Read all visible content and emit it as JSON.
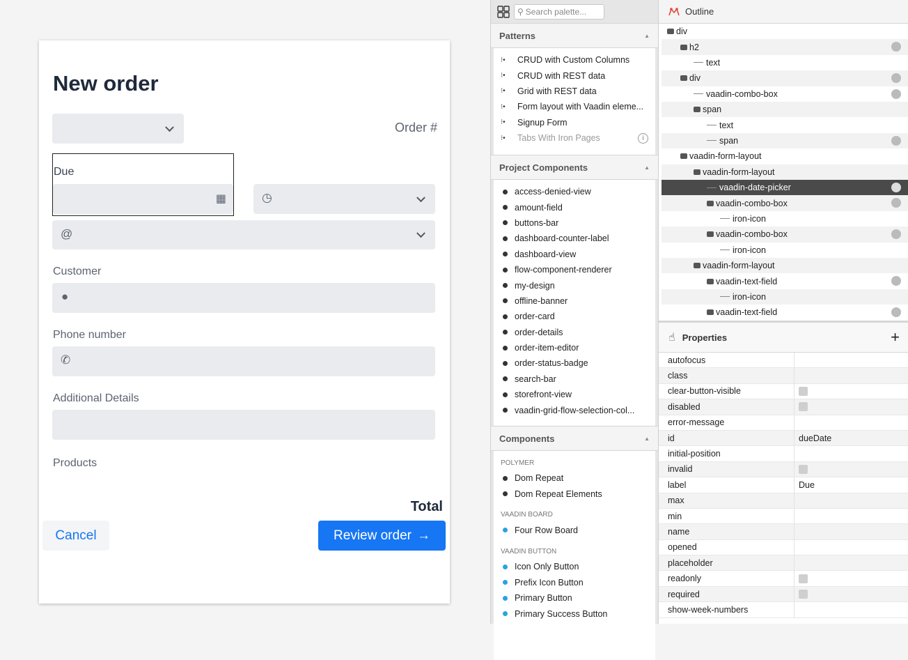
{
  "form": {
    "title": "New order",
    "order_number_label": "Order #",
    "due_label": "Due",
    "customer_label": "Customer",
    "phone_label": "Phone number",
    "details_label": "Additional Details",
    "products_label": "Products",
    "total_label": "Total",
    "cancel_label": "Cancel",
    "review_label": "Review order"
  },
  "palette": {
    "search_placeholder": "Search palette...",
    "patterns_header": "Patterns",
    "patterns": [
      {
        "label": "CRUD with Custom Columns",
        "dim": false
      },
      {
        "label": "CRUD with REST data",
        "dim": false
      },
      {
        "label": "Grid with REST data",
        "dim": false
      },
      {
        "label": "Form layout with Vaadin eleme...",
        "dim": false
      },
      {
        "label": "Signup Form",
        "dim": false
      },
      {
        "label": "Tabs With Iron Pages",
        "dim": true
      }
    ],
    "project_header": "Project Components",
    "project_components": [
      "access-denied-view",
      "amount-field",
      "buttons-bar",
      "dashboard-counter-label",
      "dashboard-view",
      "flow-component-renderer",
      "my-design",
      "offline-banner",
      "order-card",
      "order-details",
      "order-item-editor",
      "order-status-badge",
      "search-bar",
      "storefront-view",
      "vaadin-grid-flow-selection-col..."
    ],
    "components_header": "Components",
    "categories": [
      {
        "name": "POLYMER",
        "color": "dark",
        "items": [
          "Dom Repeat",
          "Dom Repeat Elements"
        ]
      },
      {
        "name": "VAADIN BOARD",
        "color": "blue",
        "items": [
          "Four Row Board"
        ]
      },
      {
        "name": "VAADIN BUTTON",
        "color": "blue",
        "items": [
          "Icon Only Button",
          "Prefix Icon Button",
          "Primary Button",
          "Primary Success Button"
        ]
      }
    ]
  },
  "outline": {
    "title": "Outline",
    "nodes": [
      {
        "label": "div",
        "depth": 0,
        "kind": "toggle",
        "ghost": false,
        "sel": false
      },
      {
        "label": "h2",
        "depth": 1,
        "kind": "toggle",
        "ghost": true,
        "sel": false
      },
      {
        "label": "text",
        "depth": 2,
        "kind": "line",
        "ghost": false,
        "sel": false
      },
      {
        "label": "div",
        "depth": 1,
        "kind": "toggle",
        "ghost": true,
        "sel": false
      },
      {
        "label": "vaadin-combo-box",
        "depth": 2,
        "kind": "line",
        "ghost": true,
        "sel": false
      },
      {
        "label": "span",
        "depth": 2,
        "kind": "toggle",
        "ghost": false,
        "sel": false
      },
      {
        "label": "text",
        "depth": 3,
        "kind": "line",
        "ghost": false,
        "sel": false
      },
      {
        "label": "span",
        "depth": 3,
        "kind": "line",
        "ghost": true,
        "sel": false
      },
      {
        "label": "vaadin-form-layout",
        "depth": 1,
        "kind": "toggle",
        "ghost": false,
        "sel": false
      },
      {
        "label": "vaadin-form-layout",
        "depth": 2,
        "kind": "toggle",
        "ghost": false,
        "sel": false
      },
      {
        "label": "vaadin-date-picker",
        "depth": 3,
        "kind": "line",
        "ghost": true,
        "sel": true
      },
      {
        "label": "vaadin-combo-box",
        "depth": 3,
        "kind": "toggle",
        "ghost": true,
        "sel": false
      },
      {
        "label": "iron-icon",
        "depth": 4,
        "kind": "line",
        "ghost": false,
        "sel": false
      },
      {
        "label": "vaadin-combo-box",
        "depth": 3,
        "kind": "toggle",
        "ghost": true,
        "sel": false
      },
      {
        "label": "iron-icon",
        "depth": 4,
        "kind": "line",
        "ghost": false,
        "sel": false
      },
      {
        "label": "vaadin-form-layout",
        "depth": 2,
        "kind": "toggle",
        "ghost": false,
        "sel": false
      },
      {
        "label": "vaadin-text-field",
        "depth": 3,
        "kind": "toggle",
        "ghost": true,
        "sel": false
      },
      {
        "label": "iron-icon",
        "depth": 4,
        "kind": "line",
        "ghost": false,
        "sel": false
      },
      {
        "label": "vaadin-text-field",
        "depth": 3,
        "kind": "toggle",
        "ghost": true,
        "sel": false
      }
    ]
  },
  "properties": {
    "title": "Properties",
    "rows": [
      {
        "key": "autofocus",
        "value": "",
        "check": false
      },
      {
        "key": "class",
        "value": "",
        "check": false
      },
      {
        "key": "clear-button-visible",
        "value": "",
        "check": true
      },
      {
        "key": "disabled",
        "value": "",
        "check": true
      },
      {
        "key": "error-message",
        "value": "",
        "check": false
      },
      {
        "key": "id",
        "value": "dueDate",
        "check": false
      },
      {
        "key": "initial-position",
        "value": "",
        "check": false
      },
      {
        "key": "invalid",
        "value": "",
        "check": true
      },
      {
        "key": "label",
        "value": "Due",
        "check": false
      },
      {
        "key": "max",
        "value": "",
        "check": false
      },
      {
        "key": "min",
        "value": "",
        "check": false
      },
      {
        "key": "name",
        "value": "",
        "check": false
      },
      {
        "key": "opened",
        "value": "",
        "check": false
      },
      {
        "key": "placeholder",
        "value": "",
        "check": false
      },
      {
        "key": "readonly",
        "value": "",
        "check": true
      },
      {
        "key": "required",
        "value": "",
        "check": true
      },
      {
        "key": "show-week-numbers",
        "value": "",
        "check": false
      }
    ]
  }
}
